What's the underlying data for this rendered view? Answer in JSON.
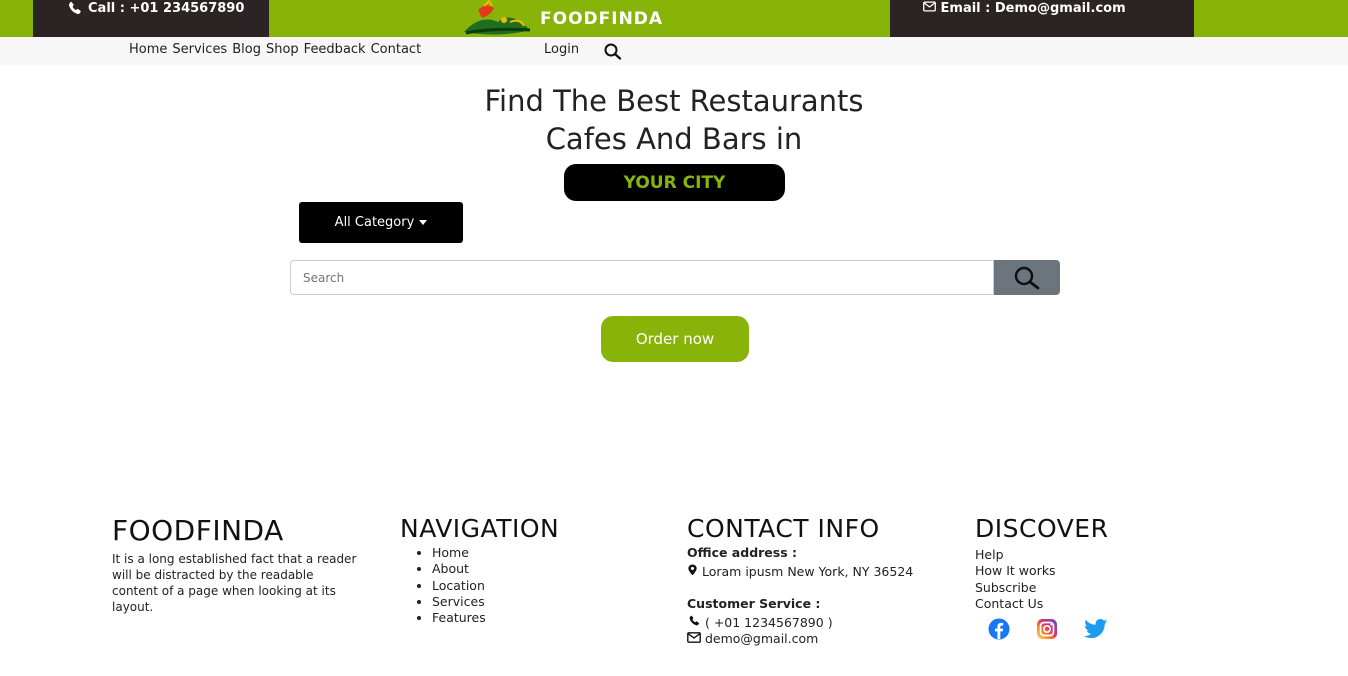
{
  "header": {
    "call_text": "Call : +01 234567890",
    "brand_name": "FOODFINDA",
    "email_text": "Email : Demo@gmail.com"
  },
  "nav": {
    "links": [
      "Home",
      "Services",
      "Blog",
      "Shop",
      "Feedback",
      "Contact"
    ],
    "login": "Login"
  },
  "hero": {
    "line1": "Find The Best Restaurants",
    "line2": "Cafes And Bars in",
    "city": "YOUR CITY"
  },
  "search": {
    "category": "All Category",
    "placeholder": "Search",
    "order_label": "Order now"
  },
  "footer": {
    "brand": {
      "title": "FOODFINDA",
      "text": "It is a long established fact that a reader will be distracted by the readable content of a page when looking at its layout."
    },
    "navigation": {
      "title": "NAVIGATION",
      "items": [
        "Home",
        "About",
        "Location",
        "Services",
        "Features"
      ]
    },
    "contact": {
      "title": "CONTACT INFO",
      "office_label": "Office address :",
      "address": "Loram ipusm New York, NY 36524",
      "service_label": "Customer Service :",
      "phone": "( +01 1234567890 )",
      "email": "demo@gmail.com"
    },
    "discover": {
      "title": "DISCOVER",
      "items": [
        "Help",
        "How It works",
        "Subscribe",
        "Contact Us"
      ]
    }
  },
  "colors": {
    "accent": "#88b40a",
    "dark": "#2c2424",
    "search_button": "#6c757d"
  },
  "icons": [
    "phone-icon",
    "envelope-icon",
    "search-icon",
    "map-pin-icon",
    "facebook-icon",
    "instagram-icon",
    "twitter-icon"
  ]
}
